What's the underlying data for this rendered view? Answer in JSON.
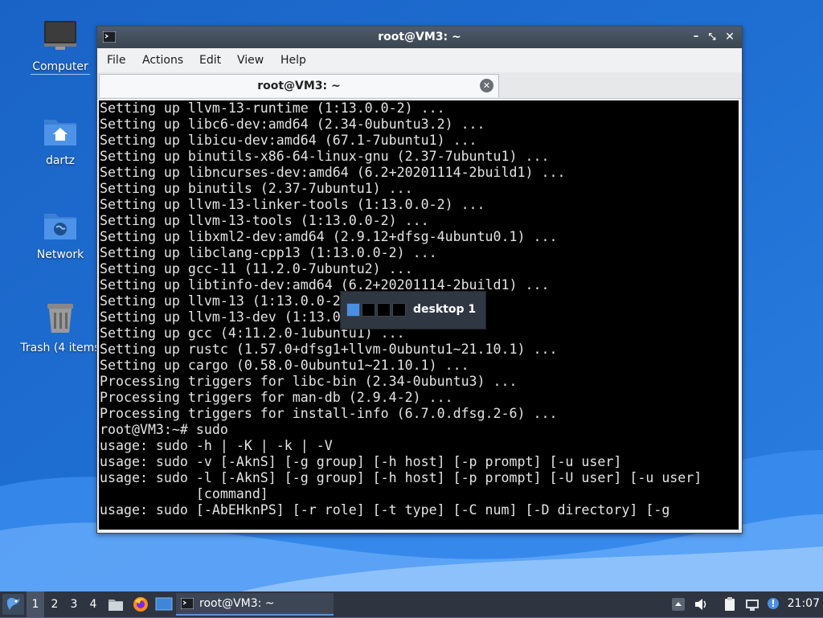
{
  "desktop": {
    "icons": [
      {
        "label": "Computer"
      },
      {
        "label": "dartz"
      },
      {
        "label": "Network"
      },
      {
        "label": "Trash (4 items"
      }
    ]
  },
  "window": {
    "title": "root@VM3: ~",
    "menu": [
      "File",
      "Actions",
      "Edit",
      "View",
      "Help"
    ],
    "tab_title": "root@VM3: ~",
    "lines": [
      "Setting up llvm-13-runtime (1:13.0.0-2) ...",
      "Setting up libc6-dev:amd64 (2.34-0ubuntu3.2) ...",
      "Setting up libicu-dev:amd64 (67.1-7ubuntu1) ...",
      "Setting up binutils-x86-64-linux-gnu (2.37-7ubuntu1) ...",
      "Setting up libncurses-dev:amd64 (6.2+20201114-2build1) ...",
      "Setting up binutils (2.37-7ubuntu1) ...",
      "Setting up llvm-13-linker-tools (1:13.0.0-2) ...",
      "Setting up llvm-13-tools (1:13.0.0-2) ...",
      "Setting up libxml2-dev:amd64 (2.9.12+dfsg-4ubuntu0.1) ...",
      "Setting up libclang-cpp13 (1:13.0.0-2) ...",
      "Setting up gcc-11 (11.2.0-7ubuntu2) ...",
      "Setting up libtinfo-dev:amd64 (6.2+20201114-2build1) ...",
      "Setting up llvm-13 (1:13.0.0-2",
      "Setting up llvm-13-dev (1:13.0",
      "Setting up gcc (4:11.2.0-1ubuntu1) ...",
      "Setting up rustc (1.57.0+dfsg1+llvm-0ubuntu1~21.10.1) ...",
      "Setting up cargo (0.58.0-0ubuntu1~21.10.1) ...",
      "Processing triggers for libc-bin (2.34-0ubuntu3) ...",
      "Processing triggers for man-db (2.9.4-2) ...",
      "Processing triggers for install-info (6.7.0.dfsg.2-6) ...",
      "root@VM3:~# sudo",
      "usage: sudo -h | -K | -k | -V",
      "usage: sudo -v [-AknS] [-g group] [-h host] [-p prompt] [-u user]",
      "usage: sudo -l [-AknS] [-g group] [-h host] [-p prompt] [-U user] [-u user]",
      "            [command]",
      "usage: sudo [-AbEHknPS] [-r role] [-t type] [-C num] [-D directory] [-g"
    ]
  },
  "popup": {
    "label": "desktop 1"
  },
  "taskbar": {
    "workspaces": [
      "1",
      "2",
      "3",
      "4"
    ],
    "active_workspace": "1",
    "task_label": "root@VM3: ~",
    "clock": "21:07"
  },
  "colors": {
    "wallpaper_blue": "#1f6fd0",
    "taskbar": "#2e3440",
    "titlebar": "#3b4552",
    "accent": "#4a90e2"
  },
  "icons": [
    "computer-icon",
    "home-folder-icon",
    "network-folder-icon",
    "trash-icon",
    "terminal-icon",
    "start-menu-icon",
    "file-manager-icon",
    "firefox-icon",
    "show-desktop-icon",
    "volume-icon",
    "clipboard-icon",
    "network-tray-icon",
    "update-notifier-icon",
    "tray-expand-icon"
  ]
}
